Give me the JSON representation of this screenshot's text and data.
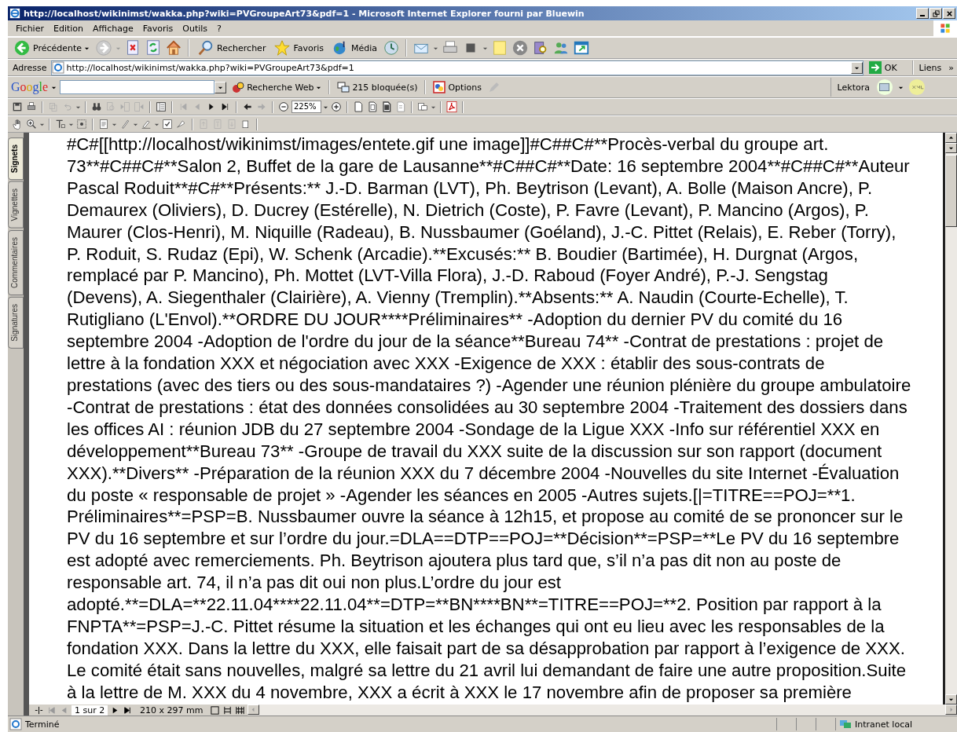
{
  "window": {
    "title": "http://localhost/wikinimst/wakka.php?wiki=PVGroupeArt73&pdf=1 - Microsoft Internet Explorer fourni par Bluewin"
  },
  "menu": [
    "Fichier",
    "Edition",
    "Affichage",
    "Favoris",
    "Outils",
    "?"
  ],
  "toolbar": {
    "back": "Précédente",
    "search": "Rechercher",
    "favorites": "Favoris",
    "media": "Média"
  },
  "address": {
    "label": "Adresse",
    "value": "http://localhost/wikinimst/wakka.php?wiki=PVGroupeArt73&pdf=1",
    "go": "OK",
    "links": "Liens",
    "more": "»"
  },
  "google": {
    "logo": "Google",
    "search_web": "Recherche Web",
    "blocked": "215 bloquée(s)",
    "options": "Options",
    "lektora": "Lektora"
  },
  "pdf_toolbar": {
    "zoom": "225%"
  },
  "side_tabs": [
    {
      "label": "Signets",
      "selected": true
    },
    {
      "label": "Vignettes",
      "selected": false
    },
    {
      "label": "Commentaires",
      "selected": false
    },
    {
      "label": "Signatures",
      "selected": false
    }
  ],
  "document_lines": [
    "#C#[[http://localhost/wikinimst/images/entete.gif une image]]#C##C#**Procès-verbal du groupe art.",
    "73**#C##C#**Salon 2, Buffet de la gare de Lausanne**#C##C#**Date: 16 septembre 2004**#C##C#**Auteur",
    "Pascal Roduit**#C#**Présents:** J.-D. Barman (LVT), Ph. Beytrison (Levant), A. Bolle (Maison Ancre), P.",
    "Demaurex (Oliviers), D. Ducrey (Estérelle), N. Dietrich (Coste), P. Favre (Levant), P. Mancino (Argos), P.",
    "Maurer (Clos-Henri), M. Niquille (Radeau), B. Nussbaumer (Goéland), J.-C. Pittet (Relais), E. Reber (Torry),",
    "P. Roduit, S. Rudaz (Epi), W. Schenk (Arcadie).**Excusés:** B. Boudier (Bartimée), H. Durgnat (Argos,",
    "remplacé par P. Mancino), Ph. Mottet (LVT-Villa Flora), J.-D. Raboud (Foyer André), P.-J. Sengstag",
    "(Devens), A. Siegenthaler (Clairière), A. Vienny (Tremplin).**Absents:** A. Naudin (Courte-Echelle), T.",
    "Rutigliano (L'Envol).**ORDRE DU JOUR****Préliminaires** -Adoption du dernier PV du comité du 16",
    "septembre 2004 -Adoption de l'ordre du jour de la séance**Bureau 74** -Contrat de prestations : projet de",
    "lettre à la fondation XXX et négociation avec XXX -Exigence de XXX : établir des sous-contrats de",
    "prestations (avec des tiers ou des sous-mandataires ?) -Agender une réunion plénière du groupe ambulatoire",
    "-Contrat de prestations : état des données consolidées au 30 septembre 2004 -Traitement des dossiers dans",
    "les offices AI : réunion JDB du 27 septembre 2004 -Sondage de la Ligue XXX -Info sur référentiel XXX en",
    "développement**Bureau 73** -Groupe de travail du XXX suite de la discussion sur son rapport (document",
    "XXX).**Divers** -Préparation de la réunion XXX du 7 décembre 2004 -Nouvelles du site Internet -Évaluation",
    "du poste « responsable de projet » -Agender les séances en 2005 -Autres sujets.[|=TITRE==POJ=**1.",
    "Préliminaires**=PSP=B. Nussbaumer ouvre la séance à 12h15, et propose au comité de se prononcer sur le",
    "PV du 16 septembre et sur l’ordre du jour.=DLA==DTP==POJ=**Décision**=PSP=**Le PV du 16 septembre",
    "est adopté avec remerciements. Ph. Beytrison ajoutera plus tard que, s’il n’a pas dit non au poste de",
    "responsable art. 74, il n’a pas dit oui non plus.L’ordre du jour est",
    "adopté.**=DLA=**22.11.04****22.11.04**=DTP=**BN****BN**=TITRE==POJ=**2. Position par rapport à la",
    "FNPTA**=PSP=J.-C. Pittet résume la situation et les échanges qui ont eu lieu avec les responsables de la",
    "fondation XXX. Dans la lettre du XXX, elle faisait part de sa désapprobation par rapport à l’exigence de XXX.",
    "Le comité était sans nouvelles, malgré sa lettre du 21 avril lui demandant de faire une autre proposition.Suite",
    "à la lettre de M. XXX du 4 novembre, XXX a écrit à XXX le 17 novembre afin de proposer sa première"
  ],
  "page_nav": {
    "page": "1 sur 2",
    "size": "210 x 297 mm"
  },
  "status_bar": {
    "text": "Terminé",
    "zone": "Intranet local"
  }
}
